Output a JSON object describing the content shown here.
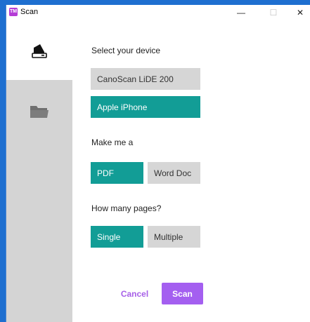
{
  "window": {
    "title": "Scan",
    "app_icon_text": "TM",
    "minimize_glyph": "—",
    "maximize_glyph": "☐",
    "close_glyph": "✕"
  },
  "sidebar": {
    "items": [
      {
        "icon": "scanner-icon",
        "active": true
      },
      {
        "icon": "folder-icon",
        "active": false
      }
    ]
  },
  "device": {
    "label": "Select your device",
    "options": [
      {
        "label": "CanoScan LiDE 200",
        "selected": false
      },
      {
        "label": "Apple iPhone",
        "selected": true
      }
    ]
  },
  "format": {
    "label": "Make me a",
    "options": [
      {
        "label": "PDF",
        "selected": true
      },
      {
        "label": "Word Doc",
        "selected": false
      }
    ]
  },
  "pages": {
    "label": "How many pages?",
    "options": [
      {
        "label": "Single",
        "selected": true
      },
      {
        "label": "Multiple",
        "selected": false
      }
    ]
  },
  "actions": {
    "cancel_label": "Cancel",
    "scan_label": "Scan"
  },
  "colors": {
    "selected": "#129d96",
    "unselected": "#d6d6d6",
    "primary": "#a45ff0",
    "sidebar": "#d4d4d4"
  }
}
